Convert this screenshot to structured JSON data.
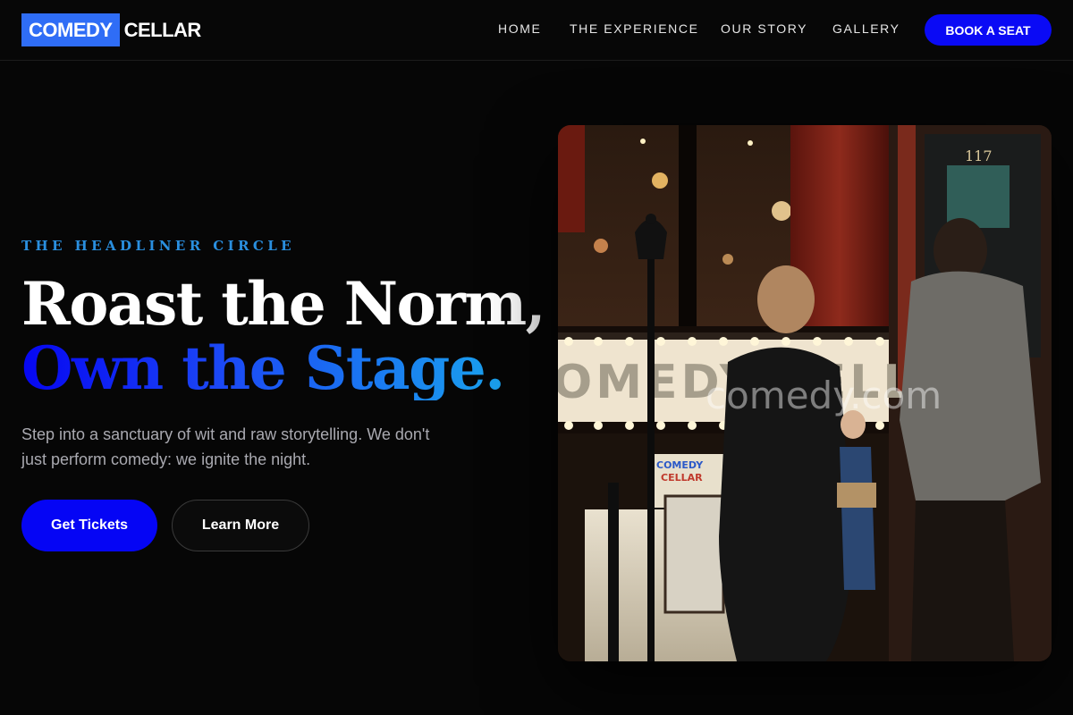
{
  "header": {
    "logo_box": "COMEDY",
    "logo_text": "CELLAR",
    "nav": [
      {
        "label": "HOME"
      },
      {
        "label": "THE EXPERIENCE"
      },
      {
        "label": "OUR STORY"
      },
      {
        "label": "GALLERY"
      }
    ],
    "cta_label": "BOOK A SEAT"
  },
  "hero": {
    "eyebrow": "THE HEADLINER CIRCLE",
    "headline_line1": "Roast the Norm,",
    "headline_line2": "Own the Stage.",
    "subtext": "Step into a sanctuary of wit and raw storytelling. We don't just perform comedy: we ignite the night.",
    "primary_button": "Get Tickets",
    "secondary_button": "Learn More"
  },
  "photo": {
    "sign_text": "OMEDY CELLAR",
    "door_number": "117",
    "poster_top": "COMEDY",
    "poster_bottom": "CELLAR",
    "watermark": "comedy.com"
  },
  "colors": {
    "accent_blue": "#0a0af5",
    "logo_blue": "#2f6df6",
    "eyebrow_blue": "#2a8fdf",
    "background": "#060606"
  }
}
